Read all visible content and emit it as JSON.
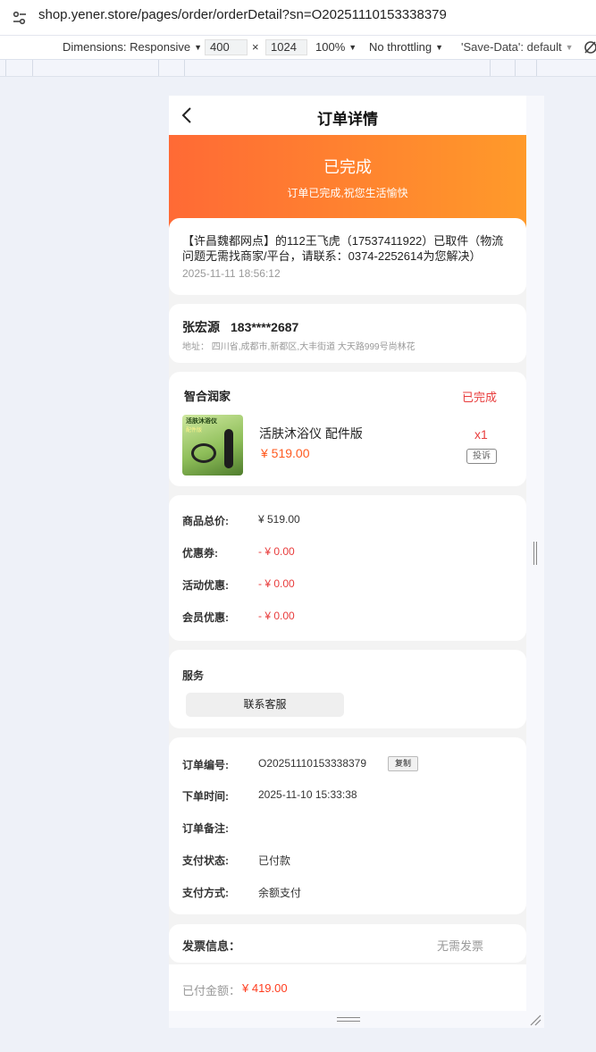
{
  "browser": {
    "url": "shop.yener.store/pages/order/orderDetail?sn=O20251110153338379",
    "dimensions_label": "Dimensions: Responsive",
    "width": "400",
    "times": "×",
    "height": "1024",
    "zoom": "100%",
    "throttling": "No throttling",
    "save_data": "'Save-Data': default"
  },
  "nav": {
    "title": "订单详情"
  },
  "hero": {
    "status": "已完成",
    "subtitle": "订单已完成,祝您生活愉快"
  },
  "logistics": {
    "text": "【许昌魏都网点】的112王飞虎（17537411922）已取件（物流问题无需找商家/平台，请联系：0374-2252614为您解决）",
    "time": "2025-11-11 18:56:12"
  },
  "address": {
    "name": "张宏源",
    "phone": "183****2687",
    "line": "地址：  四川省,成都市,新都区,大丰街道 大天路999号尚林花"
  },
  "store": {
    "name": "智合润家",
    "status": "已完成",
    "product": {
      "image_tag": "活肤沐浴仪",
      "image_tag2": "配件版",
      "name": "活肤沐浴仪 配件版",
      "price": "¥ 519.00",
      "qty": "x1",
      "complain": "投诉"
    }
  },
  "prices": [
    {
      "label": "商品总价:",
      "value": "¥ 519.00",
      "red": false
    },
    {
      "label": "优惠券:",
      "value": "- ¥ 0.00",
      "red": true
    },
    {
      "label": "活动优惠:",
      "value": "- ¥ 0.00",
      "red": true
    },
    {
      "label": "会员优惠:",
      "value": "- ¥ 0.00",
      "red": true
    }
  ],
  "service": {
    "title": "服务",
    "button": "联系客服"
  },
  "order_info": [
    {
      "label": "订单编号:",
      "value": "O20251110153338379"
    },
    {
      "label": "下单时间:",
      "value": "2025-11-10 15:33:38"
    },
    {
      "label": "订单备注:",
      "value": ""
    },
    {
      "label": "支付状态:",
      "value": "已付款"
    },
    {
      "label": "支付方式:",
      "value": "余额支付"
    }
  ],
  "copy_label": "复制",
  "invoice": {
    "label": "发票信息：",
    "value": "无需发票"
  },
  "footer": {
    "paid_label": "已付金额：",
    "paid_value": "¥ 419.00"
  },
  "colors": {
    "accent_start": "#ff6a35",
    "accent_end": "#ff9a2a",
    "red": "#e83c3c"
  },
  "icons": [
    "tune-icon",
    "back-icon",
    "caret-down-icon"
  ]
}
